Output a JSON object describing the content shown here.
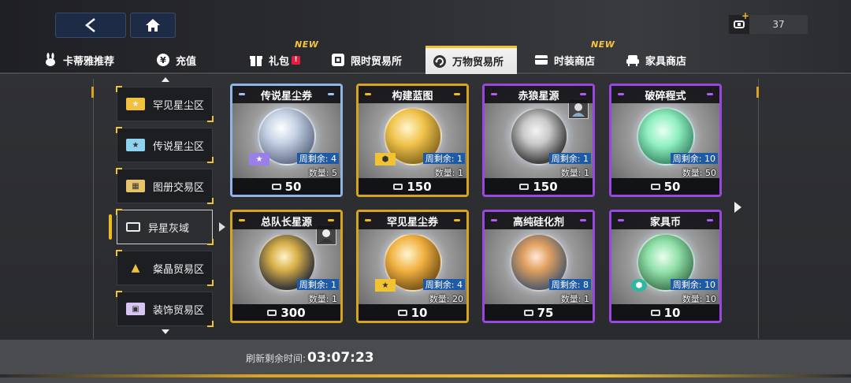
{
  "currency": {
    "amount": "37",
    "plus": "+"
  },
  "tabs": [
    {
      "label": "卡蒂雅推荐",
      "icon": "bunny-icon"
    },
    {
      "label": "充值",
      "icon": "yen-icon"
    },
    {
      "label": "礼包",
      "icon": "gift-icon",
      "new": "NEW",
      "badge": "!"
    },
    {
      "label": "限时贸易所",
      "icon": "shop-icon"
    },
    {
      "label": "万物贸易所",
      "icon": "refresh-icon",
      "active": true
    },
    {
      "label": "时装商店",
      "icon": "wardrobe-icon",
      "new": "NEW"
    },
    {
      "label": "家具商店",
      "icon": "sofa-icon"
    }
  ],
  "categories": [
    {
      "label": "罕见星尘区",
      "icon": "rare-stardust-icon"
    },
    {
      "label": "传说星尘区",
      "icon": "legend-stardust-icon"
    },
    {
      "label": "图册交易区",
      "icon": "album-icon"
    },
    {
      "label": "异星灰域",
      "icon": "currency-icon",
      "active": true
    },
    {
      "label": "粲晶贸易区",
      "icon": "crystal-icon"
    },
    {
      "label": "装饰贸易区",
      "icon": "decor-icon"
    }
  ],
  "items": [
    {
      "title": "传说星尘券",
      "weekly": "周剩余: 4",
      "qty": "数量: 5",
      "price": "50",
      "rarity": "blue"
    },
    {
      "title": "构建蓝图",
      "weekly": "周剩余: 1",
      "qty": "数量: 1",
      "price": "150",
      "rarity": "gold"
    },
    {
      "title": "赤狼星源",
      "weekly": "周剩余: 1",
      "qty": "数量: 1",
      "price": "150",
      "rarity": "purple"
    },
    {
      "title": "破碎程式",
      "weekly": "周剩余: 10",
      "qty": "数量: 50",
      "price": "50",
      "rarity": "purple"
    },
    {
      "title": "总队长星源",
      "weekly": "周剩余: 1",
      "qty": "数量: 1",
      "price": "300",
      "rarity": "gold"
    },
    {
      "title": "罕见星尘券",
      "weekly": "周剩余: 4",
      "qty": "数量: 20",
      "price": "10",
      "rarity": "gold"
    },
    {
      "title": "高纯硅化剂",
      "weekly": "周剩余: 8",
      "qty": "数量: 1",
      "price": "75",
      "rarity": "purple"
    },
    {
      "title": "家具币",
      "weekly": "周剩余: 10",
      "qty": "数量: 10",
      "price": "10",
      "rarity": "purple"
    }
  ],
  "refresh": {
    "label": "刷新剩余时间:",
    "time": "03:07:23"
  }
}
